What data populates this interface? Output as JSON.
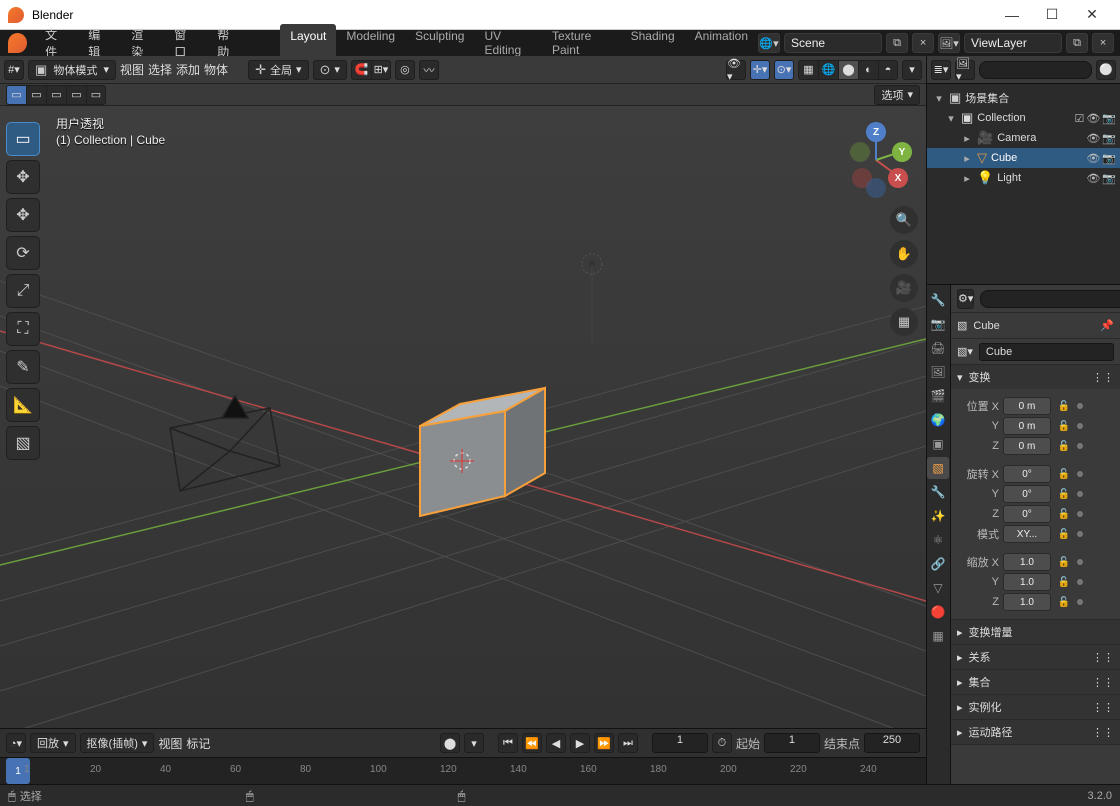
{
  "window": {
    "title": "Blender"
  },
  "menus": {
    "file": "文件",
    "edit": "编辑",
    "render": "渲染",
    "window": "窗口",
    "help": "帮助"
  },
  "tabs": {
    "layout": "Layout",
    "modeling": "Modeling",
    "sculpting": "Sculpting",
    "uv": "UV Editing",
    "texture": "Texture Paint",
    "shading": "Shading",
    "animation": "Animation"
  },
  "scene": {
    "label": "Scene"
  },
  "viewlayer": {
    "label": "ViewLayer"
  },
  "viewport": {
    "mode": "物体模式",
    "menu_view": "视图",
    "menu_select": "选择",
    "menu_add": "添加",
    "menu_object": "物体",
    "orientation": "全局",
    "options": "选项",
    "overlay_title": "用户透视",
    "overlay_context": "(1) Collection | Cube"
  },
  "nav": {
    "x": "X",
    "y": "Y",
    "z": "Z"
  },
  "outliner": {
    "root": "场景集合",
    "collection": "Collection",
    "camera": "Camera",
    "cube": "Cube",
    "light": "Light"
  },
  "properties": {
    "object_label": "Cube",
    "data_label": "Cube",
    "transform": "变换",
    "loc": "位置",
    "rot": "旋转",
    "mode_label": "模式",
    "mode_val": "XY...",
    "scale": "缩放",
    "loc_x": "0 m",
    "loc_y": "0 m",
    "loc_z": "0 m",
    "rot_x": "0°",
    "rot_y": "0°",
    "rot_z": "0°",
    "scale_x": "1.0",
    "scale_y": "1.0",
    "scale_z": "1.0",
    "delta": "变换增量",
    "relations": "关系",
    "collections": "集合",
    "instancing": "实例化",
    "motion": "运动路径"
  },
  "timeline": {
    "playback": "回放",
    "keying": "抠像(插帧)",
    "view": "视图",
    "marker": "标记",
    "current": "1",
    "start_label": "起始",
    "start": "1",
    "end_label": "结束点",
    "end": "250",
    "ticks": [
      "1",
      "20",
      "40",
      "60",
      "80",
      "100",
      "120",
      "140",
      "160",
      "180",
      "200",
      "220",
      "240"
    ]
  },
  "status": {
    "select": "选择",
    "version": "3.2.0"
  }
}
